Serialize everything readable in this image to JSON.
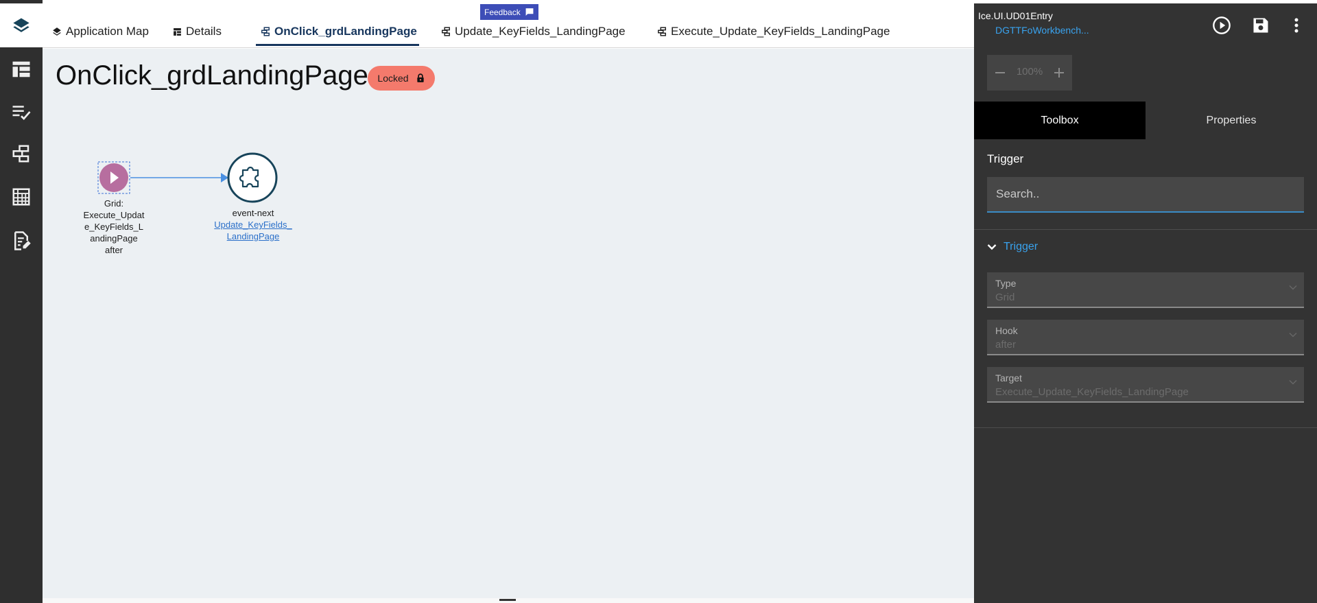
{
  "tabs": [
    {
      "label": "Application Map",
      "icon": "layers-icon"
    },
    {
      "label": "Details",
      "icon": "table-icon"
    },
    {
      "label": "OnClick_grdLandingPage",
      "icon": "workflow-icon"
    },
    {
      "label": "Update_KeyFields_LandingPage",
      "icon": "workflow-icon"
    },
    {
      "label": "Execute_Update_KeyFields_LandingPage",
      "icon": "workflow-icon"
    }
  ],
  "feedback": {
    "label": "Feedback"
  },
  "page": {
    "title": "OnClick_grdLandingPage",
    "status_badge": "Locked"
  },
  "flow": {
    "trigger_node": {
      "label": "Grid:\nExecute_Updat\ne_KeyFields_L\nandingPage\nafter"
    },
    "event_node": {
      "label": "event-next",
      "link": "Update_KeyFields_\nLandingPage"
    }
  },
  "right_panel": {
    "title": "Ice.UI.UD01Entry",
    "subtitle": "DGTTFoWorkbench...",
    "zoom": {
      "value": "100%"
    },
    "tabs": {
      "toolbox": "Toolbox",
      "properties": "Properties"
    },
    "section_label": "Trigger",
    "search": {
      "placeholder": "Search..",
      "value": ""
    },
    "accordion": {
      "title": "Trigger",
      "fields": [
        {
          "label": "Type",
          "value": "Grid"
        },
        {
          "label": "Hook",
          "value": "after"
        },
        {
          "label": "Target",
          "value": "Execute_Update_KeyFields_LandingPage"
        }
      ]
    }
  },
  "colors": {
    "accent_blue": "#39a3ef",
    "tab_active": "#17365d",
    "locked_badge": "#f47a6c",
    "trigger_node": "#b76e9f",
    "event_node_border": "#17445a",
    "connector": "#4a90e2",
    "panel_bg": "#333333",
    "rail_bg": "#2f2f2f"
  }
}
